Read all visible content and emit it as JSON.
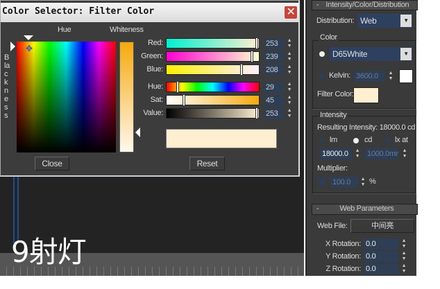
{
  "overlay_text": "9射灯",
  "dialog": {
    "title": "Color Selector: Filter Color",
    "close_icon": "close-x-icon",
    "hue_label": "Hue",
    "whiteness_label": "Whiteness",
    "blackness_label": "Blackness",
    "sliders": [
      {
        "label": "Red:",
        "value": "253",
        "fraction": 0.99
      },
      {
        "label": "Green:",
        "value": "239",
        "fraction": 0.94
      },
      {
        "label": "Blue:",
        "value": "208",
        "fraction": 0.82
      },
      {
        "label": "Hue:",
        "value": "29",
        "fraction": 0.11
      },
      {
        "label": "Sat:",
        "value": "45",
        "fraction": 0.18
      },
      {
        "label": "Value:",
        "value": "253",
        "fraction": 0.99
      }
    ],
    "swatch_color": "#fdefd0",
    "close_label": "Close",
    "reset_label": "Reset"
  },
  "panel": {
    "section1": "Intensity/Color/Distribution",
    "collapse": "-",
    "distribution_label": "Distribution:",
    "distribution_value": "Web",
    "color_group": "Color",
    "color_preset": "D65White",
    "kelvin_label": "Kelvin:",
    "kelvin_value": "3600.0",
    "filter_color_label": "Filter Color:",
    "filter_color": "#fdefd0",
    "intensity_group": "Intensity",
    "resulting": "Resulting Intensity: 18000.0 cd",
    "units": [
      "lm",
      "cd",
      "lx at"
    ],
    "intensity_value": "18000.0",
    "distance_value": "1000.0mm",
    "multiplier_label": "Multiplier:",
    "multiplier_value": "100.0",
    "percent": "%",
    "section2": "Web Parameters",
    "web_file_label": "Web File:",
    "web_file_value": "中间亮",
    "rotations": [
      {
        "label": "X Rotation:",
        "value": "0.0"
      },
      {
        "label": "Y Rotation:",
        "value": "0.0"
      },
      {
        "label": "Z Rotation:",
        "value": "0.0"
      }
    ]
  }
}
